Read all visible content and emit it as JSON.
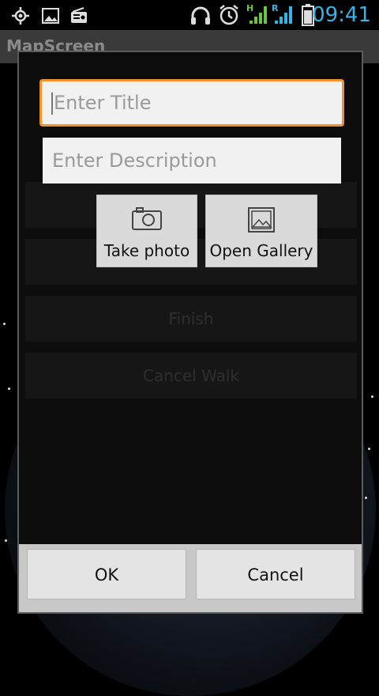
{
  "status_bar": {
    "time": "09:41",
    "icons": [
      "gps-icon",
      "image-icon",
      "radio-icon",
      "headset-icon",
      "alarm-icon",
      "signal-h-icon",
      "signal-r-icon",
      "battery-icon"
    ],
    "accent": "#33b5e5"
  },
  "app": {
    "title": "MapScreen"
  },
  "background_buttons": [
    "Finish",
    "Cancel Walk"
  ],
  "dialog": {
    "title_input": {
      "placeholder": "Enter Title",
      "value": ""
    },
    "description_input": {
      "placeholder": "Enter Description",
      "value": ""
    },
    "take_photo_label": "Take photo",
    "open_gallery_label": "Open Gallery",
    "ok_label": "OK",
    "cancel_label": "Cancel"
  },
  "colors": {
    "focus": "#f1922a"
  }
}
